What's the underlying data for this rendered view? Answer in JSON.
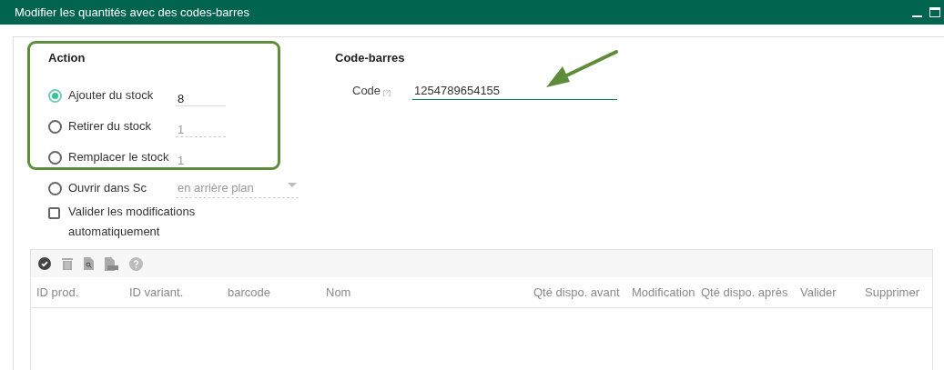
{
  "window": {
    "title": "Modifier les quantités avec des codes-barres"
  },
  "action": {
    "heading": "Action",
    "options": [
      {
        "kind": "radio",
        "label": "Ajouter du stock",
        "selected": true,
        "field": {
          "value": "8",
          "disabled": false
        }
      },
      {
        "kind": "radio",
        "label": "Retirer du stock",
        "selected": false,
        "field": {
          "value": "1",
          "disabled": true
        }
      },
      {
        "kind": "radio",
        "label": "Remplacer le stock",
        "selected": false,
        "field": {
          "value": "1",
          "disabled": true
        }
      },
      {
        "kind": "dropdown",
        "label": "Ouvrir dans Sc",
        "selected": false,
        "field": {
          "value": "en arrière plan",
          "disabled": true
        }
      },
      {
        "kind": "checkbox",
        "label": "Valider les modifications automatiquement",
        "checked": false
      }
    ]
  },
  "barcode": {
    "heading": "Code-barres",
    "label": "Code",
    "help": "[?]",
    "value": "1254789654155"
  },
  "table": {
    "columns": [
      "ID prod.",
      "ID variant.",
      "barcode",
      "Nom",
      "Qté dispo. avant",
      "Modification",
      "Qté dispo. après",
      "Valider",
      "Supprimer"
    ]
  }
}
